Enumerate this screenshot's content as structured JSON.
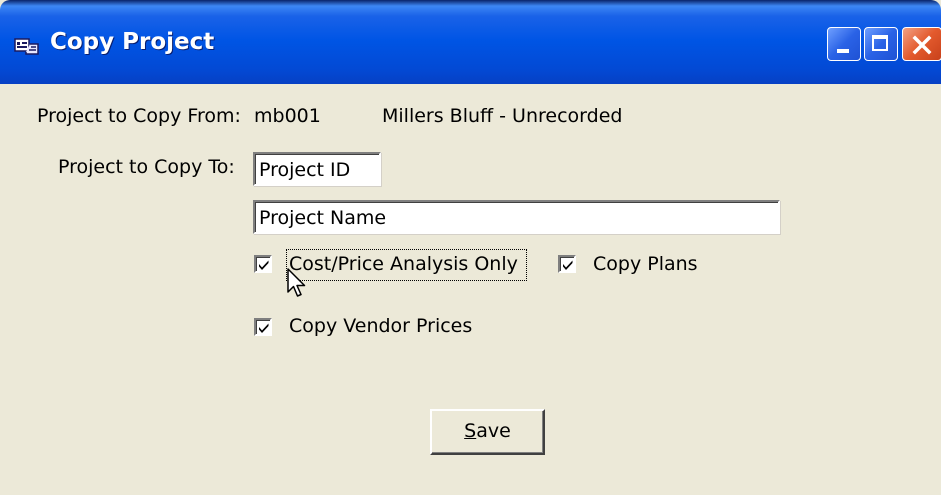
{
  "window": {
    "title": "Copy Project",
    "icon": "copy-project-app-icon",
    "controls": [
      "minimize-icon",
      "maximize-icon",
      "close-icon"
    ]
  },
  "copy_from": {
    "label": "Project to Copy From:",
    "project_id": "mb001",
    "project_name": "Millers Bluff - Unrecorded"
  },
  "copy_to": {
    "label": "Project to Copy To:",
    "project_id_value": "Project ID",
    "project_name_value": "Project Name"
  },
  "options": {
    "cost_price_analysis_only": {
      "label": "Cost/Price Analysis Only",
      "checked": true
    },
    "copy_plans": {
      "label": "Copy Plans",
      "checked": true
    },
    "copy_vendor_prices": {
      "label": "Copy Vendor Prices",
      "checked": true
    }
  },
  "save_button": {
    "mnemonic": "S",
    "rest": "ave"
  }
}
